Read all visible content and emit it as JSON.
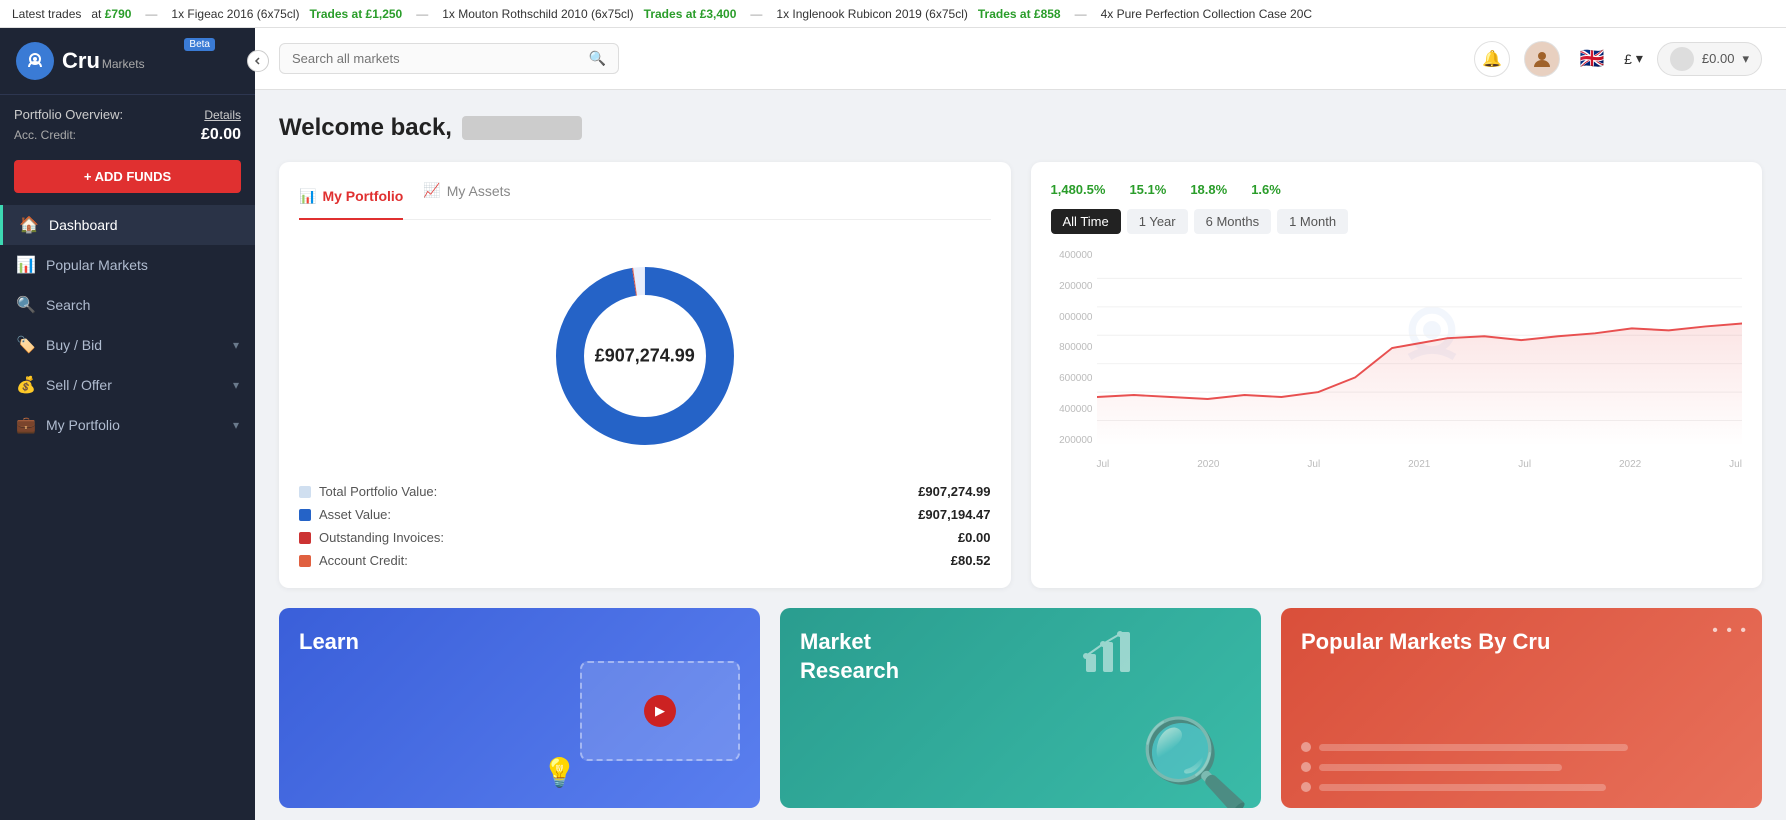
{
  "ticker": {
    "label": "Latest trades",
    "items": [
      {
        "price": "at £790",
        "sep": "—",
        "desc": "1x Figeac 2016 (6x75cl)",
        "trade_label": "Trades at £1,250",
        "sep2": "—",
        "desc2": "1x Mouton Rothschild 2010 (6x75cl)"
      },
      {
        "trade_label": "Trades at £3,400",
        "sep": "—",
        "desc": "1x Inglenook Rubicon 2019 (6x75cl)",
        "trade_label2": "Trades at £858",
        "sep2": "—",
        "desc2": "4x Pure Perfection Collection Case 20C"
      }
    ]
  },
  "sidebar": {
    "logo": "Cru",
    "logo_sub": "Markets",
    "beta_label": "Beta",
    "portfolio_title": "Portfolio Overview:",
    "details_link": "Details",
    "acc_credit_label": "Acc. Credit:",
    "acc_credit_value": "£0.00",
    "add_funds_label": "+ ADD FUNDS",
    "nav_items": [
      {
        "id": "dashboard",
        "label": "Dashboard",
        "icon": "🏠",
        "active": true
      },
      {
        "id": "popular-markets",
        "label": "Popular Markets",
        "icon": "📊",
        "active": false
      },
      {
        "id": "search",
        "label": "Search",
        "icon": "🔍",
        "active": false
      },
      {
        "id": "buy-bid",
        "label": "Buy / Bid",
        "icon": "🏷️",
        "active": false,
        "has_arrow": true
      },
      {
        "id": "sell-offer",
        "label": "Sell / Offer",
        "icon": "💰",
        "active": false,
        "has_arrow": true
      },
      {
        "id": "my-portfolio",
        "label": "My Portfolio",
        "icon": "💼",
        "active": false,
        "has_arrow": true
      }
    ]
  },
  "header": {
    "search_placeholder": "Search all markets",
    "currency": "£",
    "account_value": "£0.00"
  },
  "welcome": {
    "text": "Welcome back,"
  },
  "portfolio": {
    "tab_portfolio": "My Portfolio",
    "tab_assets": "My Assets",
    "donut_value": "£907,274.99",
    "legend": [
      {
        "label": "Total Portfolio Value:",
        "value": "£907,274.99",
        "color": "#d0dff0"
      },
      {
        "label": "Asset Value:",
        "value": "£907,194.47",
        "color": "#2563c7"
      },
      {
        "label": "Outstanding Invoices:",
        "value": "£0.00",
        "color": "#cc3333"
      },
      {
        "label": "Account Credit:",
        "value": "£80.52",
        "color": "#e06040"
      }
    ]
  },
  "chart": {
    "stats": [
      {
        "value": "1,480.5%",
        "color": "#2a9d2a"
      },
      {
        "value": "15.1%",
        "color": "#2a9d2a"
      },
      {
        "value": "18.8%",
        "color": "#2a9d2a"
      },
      {
        "value": "1.6%",
        "color": "#2a9d2a"
      }
    ],
    "timeframes": [
      {
        "label": "All Time",
        "active": true
      },
      {
        "label": "1 Year",
        "active": false
      },
      {
        "label": "6 Months",
        "active": false
      },
      {
        "label": "1 Month",
        "active": false
      }
    ],
    "y_labels": [
      "400000",
      "200000",
      "000000",
      "800000",
      "600000",
      "400000",
      "200000"
    ],
    "x_labels": [
      "Jul",
      "2020",
      "Jul",
      "2021",
      "Jul",
      "2022",
      "Jul"
    ]
  },
  "bottom_cards": {
    "learn": {
      "title": "Learn"
    },
    "research": {
      "title": "Market\nResearch"
    },
    "popular": {
      "title": "Popular Markets By Cru"
    }
  }
}
